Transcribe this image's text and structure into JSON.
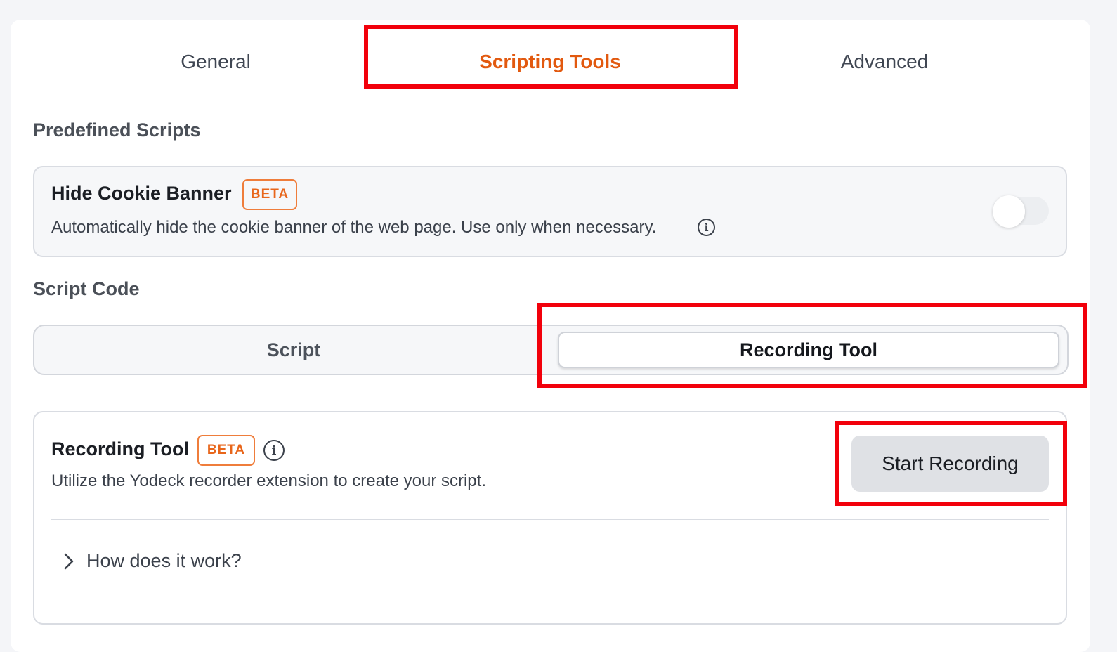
{
  "tabs": [
    {
      "label": "General"
    },
    {
      "label": "Scripting Tools"
    },
    {
      "label": "Advanced"
    }
  ],
  "active_tab": "Scripting Tools",
  "predefined": {
    "section_title": "Predefined Scripts",
    "card": {
      "title": "Hide Cookie Banner",
      "badge": "BETA",
      "description": "Automatically hide the cookie banner of the web page. Use only when necessary.",
      "toggle_on": false
    }
  },
  "script_code": {
    "section_title": "Script Code",
    "segments": [
      {
        "label": "Script"
      },
      {
        "label": "Recording Tool"
      }
    ],
    "active_segment": "Recording Tool"
  },
  "recording": {
    "title": "Recording Tool",
    "badge": "BETA",
    "description": "Utilize the Yodeck recorder extension to create your script.",
    "start_button": "Start Recording",
    "accordion_label": "How does it work?"
  },
  "colors": {
    "accent": "#e2590f",
    "badge": "#e8661b",
    "highlight": "#f2000b"
  }
}
